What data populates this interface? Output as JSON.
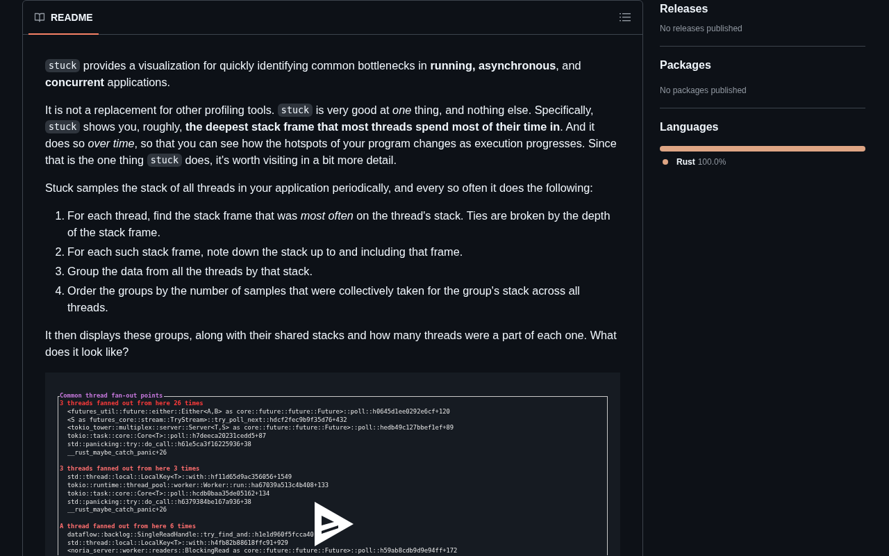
{
  "readme": {
    "tab": {
      "label": "README",
      "selected": true
    },
    "paragraphs": [
      [
        {
          "kind": "code",
          "text": "stuck"
        },
        {
          "kind": "text",
          "text": " provides a visualization for quickly identifying common bottlenecks in **running, asynchronous**, and **concurrent** applications."
        }
      ],
      [
        {
          "kind": "text",
          "text": "It is not a replacement for other profiling tools. "
        },
        {
          "kind": "code",
          "text": "stuck"
        },
        {
          "kind": "text",
          "text": " is very good at *one* thing, and nothing else. Specifically, "
        },
        {
          "kind": "code",
          "text": "stuck"
        },
        {
          "kind": "text",
          "text": " shows you, roughly, **the deepest stack frame that most threads spend most of their time in**. And it does so *over time*, so that you can see how the hotspots of your program changes as execution progresses. Since that is the one thing "
        },
        {
          "kind": "code",
          "text": "stuck"
        },
        {
          "kind": "text",
          "text": " does, it's worth visiting in a bit more detail."
        }
      ],
      [
        {
          "kind": "text",
          "text": "Stuck samples the stack of all threads in your application periodically, and every so often it does the following:"
        }
      ]
    ],
    "steps": [
      {
        "number": "1.",
        "text": "For each thread, find the stack frame that was *most often* on the thread's stack. Ties are broken by the depth of the stack frame."
      },
      {
        "number": "2.",
        "text": "For each such stack frame, note down the stack up to and including that frame."
      },
      {
        "number": "3.",
        "text": "Group the data from all the threads by that stack."
      },
      {
        "number": "4.",
        "text": "Order the groups by the number of samples that were collectively taken for the group's stack across all threads."
      }
    ],
    "closing": "It then displays these groups, along with their shared stacks and how many threads were a part of each one. What does it look like?",
    "terminal": {
      "title": "Common thread fan-out points",
      "groups": [
        {
          "header": "3 threads fanned out from here 26 times",
          "color": "#ff3b3b",
          "lines": [
            "<futures_util::future::either::Either<A,B> as core::future::future::Future>::poll::h0645d1ee0292e6cf+120",
            "<S as futures_core::stream::TryStream>::try_poll_next::hdcf2fec9b9f35d76+432",
            "<tokio_tower::multiplex::server::Server<T,S> as core::future::future::Future>::poll::hedb49c127bbef1ef+89",
            "tokio::task::core::Core<T>::poll::h7deeca20231cedd5+87",
            "std::panicking::try::do_call::h61e5ca3f16225936+38",
            "__rust_maybe_catch_panic+26"
          ]
        },
        {
          "header": "3 threads fanned out from here 3 times",
          "color": "#ff6f6f",
          "lines": [
            "std::thread::local::LocalKey<T>::with::hf11d65d9ac356056+1549",
            "tokio::runtime::thread_pool::worker::Worker::run::ha67039a513c4b408+133",
            "tokio::task::core::Core<T>::poll::hcdb0baa35de05162+134",
            "std::panicking::try::do_call::h6379384be167a936+38",
            "__rust_maybe_catch_panic+26"
          ]
        },
        {
          "header": "A thread fanned out from here 6 times",
          "color": "#ff6f6f",
          "lines": [
            "dataflow::backlog::SingleReadHandle::try_find_and::h1e1d960f5fcca40",
            "std::thread::local::LocalKey<T>::with::h4fb82b88618ffc91+929",
            "<noria_server::worker::readers::BlockingRead as core::future::future::Future>::poll::h59ab8cdb9d9e94ff+172"
          ]
        }
      ]
    }
  },
  "sidebar": {
    "sections": [
      {
        "title": "Releases",
        "note": "No releases published"
      },
      {
        "title": "Packages",
        "note": "No packages published"
      }
    ],
    "languages": {
      "title": "Languages",
      "items": [
        {
          "name": "Rust",
          "percent": "100.0%",
          "color": "#dea584",
          "level": 1.0
        }
      ]
    }
  }
}
